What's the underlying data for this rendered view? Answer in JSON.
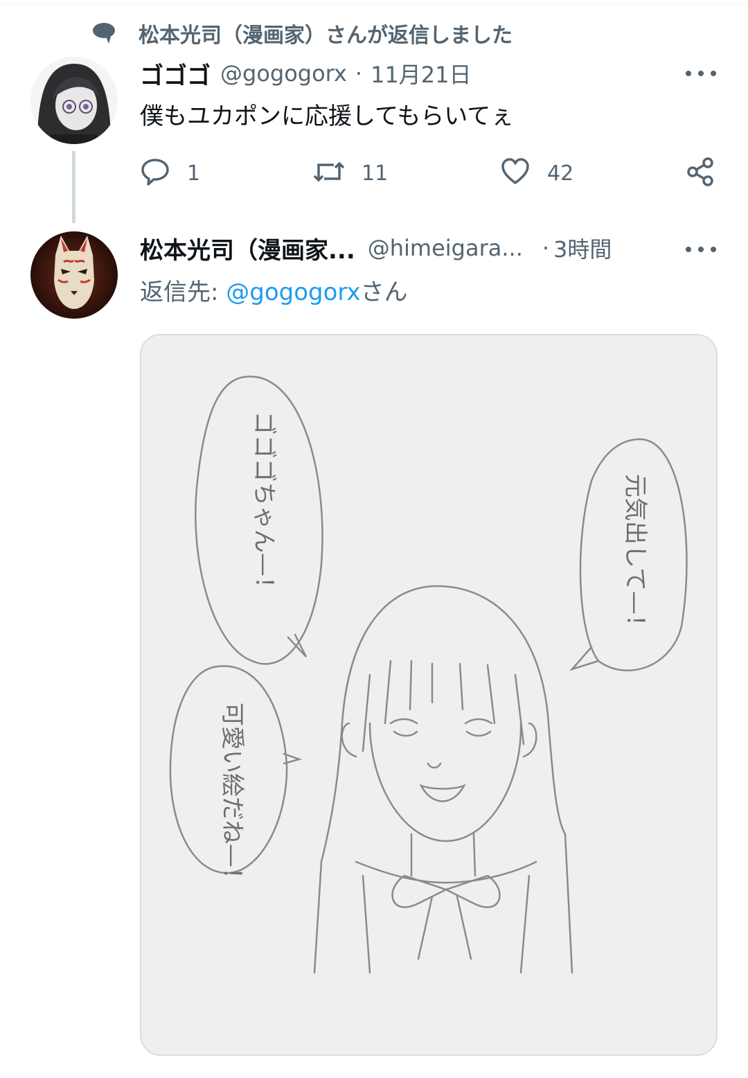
{
  "context": {
    "icon": "speech-bubble-icon",
    "text": "松本光司（漫画家）さんが返信しました"
  },
  "tweet1": {
    "avatar": "avatar-anime-glasses",
    "name": "ゴゴゴ",
    "handle": "@gogogorx",
    "separator": "·",
    "date": "11月21日",
    "text": "僕もユカポンに応援してもらいてぇ",
    "reply_count": "1",
    "retweet_count": "11",
    "like_count": "42",
    "icons": {
      "reply": "reply-icon",
      "retweet": "retweet-icon",
      "like": "heart-icon",
      "share": "share-icon",
      "more": "more-icon"
    }
  },
  "tweet2": {
    "avatar": "avatar-fox-mask",
    "name": "松本光司（漫画家...",
    "handle": "@himeigara...",
    "separator": "·",
    "time": "3時間",
    "reply_prefix": "返信先: ",
    "reply_handle": "@gogogorx",
    "reply_suffix": "さん",
    "media_text": {
      "bubble_left_top": "ゴゴゴちゃん—！",
      "bubble_right": "元気出して—！",
      "bubble_left_bottom": "可愛い絵だね—！"
    }
  },
  "colors": {
    "text_primary": "#0f1419",
    "text_secondary": "#536471",
    "link": "#1d9bf0",
    "thread_line": "#cfd9de"
  }
}
